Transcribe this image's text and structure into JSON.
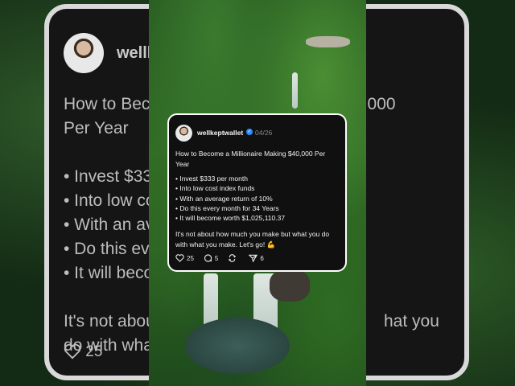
{
  "post": {
    "handle": "wellkeptwallet",
    "date": "04/26",
    "title": "How to Become a Millionaire Making $40,000 Per Year",
    "bullets": [
      "Invest $333 per month",
      "Into low cost index funds",
      "With an average return of 10%",
      "Do this every month for 34 Years",
      "It will become worth $1,025,110.37"
    ],
    "closing": "It's not about how much you make but what you do with what you make. Let's go! 💪",
    "likes": "25",
    "comments": "5",
    "shares": "6"
  },
  "background": {
    "handle_fragment": "wellk",
    "title_fragment": "How to Beco",
    "amount_fragment": "0,000",
    "per_year": "Per Year",
    "bullet_fragments": [
      "• Invest $333",
      "• Into low co",
      "• With an av",
      "• Do this eve",
      "• It will beco"
    ],
    "closing_fragment_1": "It's not abou",
    "closing_fragment_1b": "hat you",
    "closing_fragment_2": "do with wha",
    "likes": "25"
  },
  "colors": {
    "verified": "#2d8cff",
    "card_bg": "#101010",
    "card_border": "#ffffff"
  },
  "icons": [
    "heart-icon",
    "comment-icon",
    "repost-icon",
    "share-icon",
    "verified-icon",
    "flexed-biceps-emoji"
  ]
}
